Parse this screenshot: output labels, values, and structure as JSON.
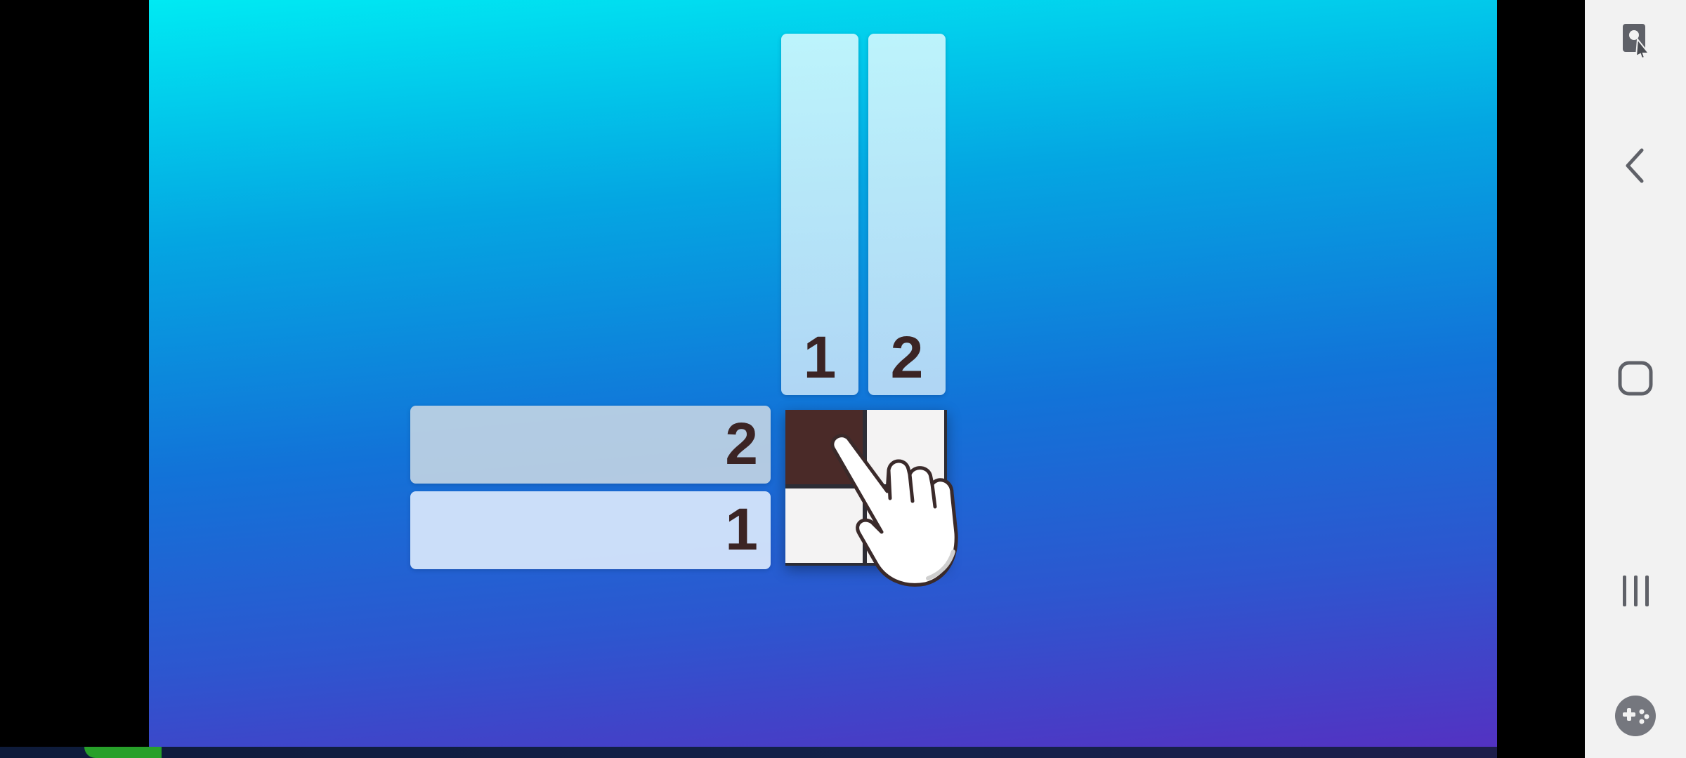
{
  "puzzle": {
    "column_clues": [
      "1",
      "2"
    ],
    "row_clues": [
      "2",
      "1"
    ],
    "grid": [
      [
        "filled",
        "empty"
      ],
      [
        "empty",
        "empty"
      ]
    ]
  },
  "colors": {
    "filled_cell": "#4a2a28",
    "empty_cell": "#f4f3f3",
    "clue_number": "#3b2424",
    "progress": "#27a02a"
  },
  "navbar": {
    "buttons": [
      {
        "name": "screenshot-tool-icon"
      },
      {
        "name": "back-icon"
      },
      {
        "name": "home-icon"
      },
      {
        "name": "recents-icon"
      },
      {
        "name": "game-launcher-icon"
      }
    ]
  }
}
